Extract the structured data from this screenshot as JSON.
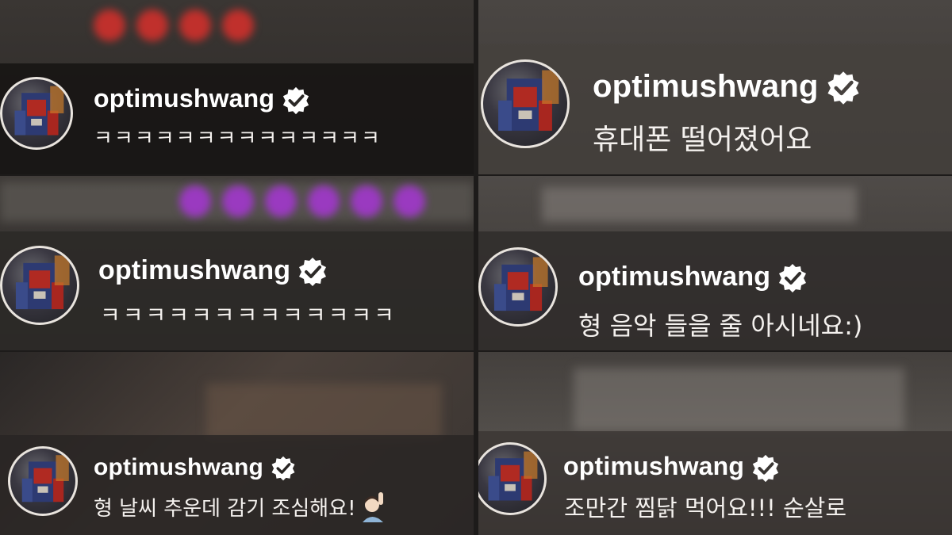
{
  "panels": [
    {
      "username": "optimushwang",
      "message": "ㅋㅋㅋㅋㅋㅋㅋㅋㅋㅋㅋㅋㅋㅋ",
      "verified": true
    },
    {
      "username": "optimushwang",
      "message": "휴대폰 떨어졌어요",
      "verified": true
    },
    {
      "username": "optimushwang",
      "message": "ㅋㅋㅋㅋㅋㅋㅋㅋㅋㅋㅋㅋㅋ",
      "verified": true
    },
    {
      "username": "optimushwang",
      "message": "형 음악 들을 줄 아시네요:)",
      "verified": true
    },
    {
      "username": "optimushwang",
      "message": "형 날씨 추운데 감기 조심해요!",
      "verified": true,
      "emoji": "raising-hand-emoji"
    },
    {
      "username": "optimushwang",
      "message": "조만간 찜닭 먹어요!!! 순살로",
      "verified": true
    }
  ],
  "colors": {
    "verified_badge": "#ffffff",
    "badge_check": "#2b2826",
    "avatar_ring": "#e9e4de",
    "text": "#ffffff"
  }
}
